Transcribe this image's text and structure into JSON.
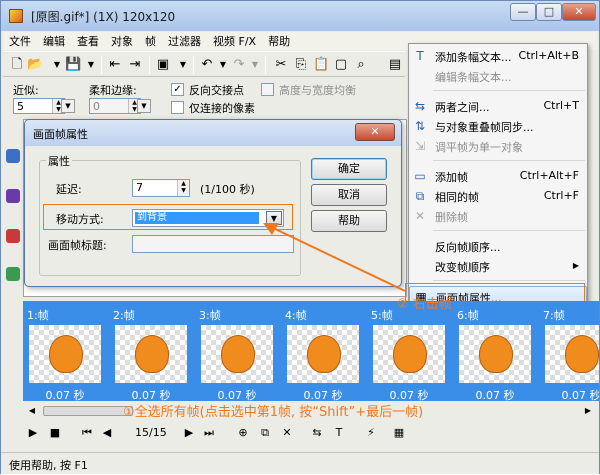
{
  "window": {
    "title": "[原图.gif*] (1X) 120x120",
    "min": "—",
    "max": "□",
    "close": "✕"
  },
  "menu": [
    "文件",
    "编辑",
    "查看",
    "对象",
    "帧",
    "过滤器",
    "视频 F/X",
    "帮助"
  ],
  "options": {
    "delay_label": "近似:",
    "delay_value": "5",
    "feather_label": "柔和边缘:",
    "feather_value": "0",
    "reverse_label": "反向交接点",
    "reverse_checked": "✓",
    "ratio_label": "高度与宽度均衡",
    "contiguous_label": "仅连接的像素"
  },
  "dialog": {
    "title": "画面帧属性",
    "group_title": "属性",
    "delay_label": "延迟:",
    "delay_value": "7",
    "delay_unit": "(1/100 秒)",
    "method_label": "移动方式:",
    "method_value": "到背景",
    "frame_title_label": "画面帧标题:",
    "ok": "确定",
    "cancel": "取消",
    "help": "帮助"
  },
  "context_menu": [
    {
      "icon": "add-banner-text-icon",
      "label": "添加条幅文本...",
      "shortcut": "Ctrl+Alt+B",
      "disabled": false
    },
    {
      "icon": "",
      "label": "编辑条幅文本...",
      "shortcut": "",
      "disabled": true
    },
    {
      "icon": "tween-icon",
      "label": "两者之间...",
      "shortcut": "Ctrl+T",
      "disabled": false
    },
    {
      "icon": "sync-icon",
      "label": "与对象重叠帧同步...",
      "shortcut": "",
      "disabled": false
    },
    {
      "icon": "flatten-icon",
      "label": "调平帧为单一对象",
      "shortcut": "",
      "disabled": true
    },
    {
      "icon": "add-frame-icon",
      "label": "添加帧",
      "shortcut": "Ctrl+Alt+F",
      "disabled": false
    },
    {
      "icon": "duplicate-frame-icon",
      "label": "相同的帧",
      "shortcut": "Ctrl+F",
      "disabled": false
    },
    {
      "icon": "delete-frame-icon",
      "label": "删除帧",
      "shortcut": "",
      "disabled": true
    },
    {
      "icon": "",
      "label": "反向帧顺序...",
      "shortcut": "",
      "disabled": false
    },
    {
      "icon": "",
      "label": "改变帧顺序",
      "shortcut": "▶",
      "disabled": false
    },
    {
      "icon": "frame-properties-icon",
      "label": "画面帧属性...",
      "shortcut": "",
      "disabled": false
    }
  ],
  "frames": [
    {
      "label": "1:帧",
      "delay": "0.07 秒"
    },
    {
      "label": "2:帧",
      "delay": "0.07 秒"
    },
    {
      "label": "3:帧",
      "delay": "0.07 秒"
    },
    {
      "label": "4:帧",
      "delay": "0.07 秒"
    },
    {
      "label": "5:帧",
      "delay": "0.07 秒"
    },
    {
      "label": "6:帧",
      "delay": "0.07 秒"
    },
    {
      "label": "7:帧",
      "delay": "0.07 秒"
    }
  ],
  "playbar": {
    "counter": "15/15"
  },
  "status": "使用帮助, 按 F1",
  "annotations": {
    "step2": "② 右击帧",
    "step1": "①全选所有帧(点击选中第1帧, 按“Shift”+最后一帧)"
  },
  "colors": {
    "accent": "#f0781e",
    "frame_strip": "#3b8ee8",
    "selection": "#3399ff"
  }
}
